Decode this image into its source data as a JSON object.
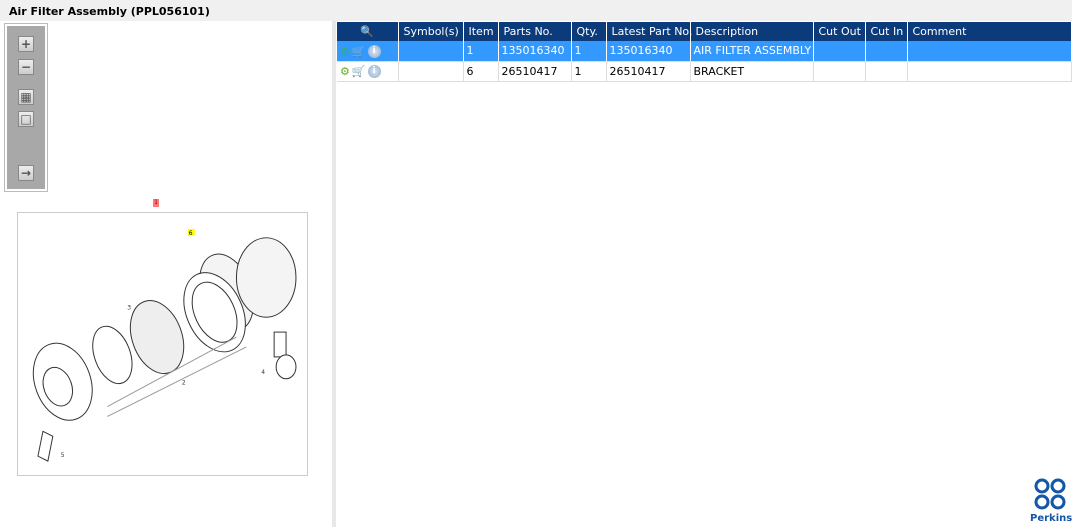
{
  "title": "Air Filter Assembly (PPL056101)",
  "toolbar": [
    "zoom-in",
    "zoom-out",
    "fit-all",
    "fit-window",
    "export"
  ],
  "drawing": {
    "callouts": [
      "1",
      "2",
      "3",
      "4",
      "5",
      "6"
    ]
  },
  "table": {
    "headers": [
      "",
      "Symbol(s)",
      "Item",
      "Parts No.",
      "Qty.",
      "Latest Part No.",
      "Description",
      "Cut Out",
      "Cut In",
      "Comment"
    ],
    "rows": [
      {
        "item": "1",
        "parts_no": "135016340",
        "qty": "1",
        "latest": "135016340",
        "description": "AIR FILTER ASSEMBLY",
        "selected": true
      },
      {
        "item": "6",
        "parts_no": "26510417",
        "qty": "1",
        "latest": "26510417",
        "description": "BRACKET",
        "selected": false
      }
    ]
  },
  "logo": "Perkins",
  "colors": {
    "header": "#0b3b7a",
    "selected": "#3399ff",
    "logo": "#1456a8"
  }
}
